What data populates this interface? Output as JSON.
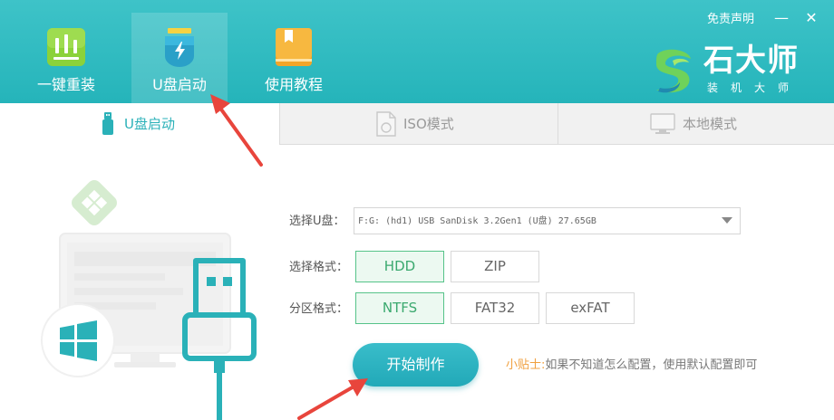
{
  "app": {
    "brand_name": "石大师",
    "brand_sub": "装机大师",
    "disclaimer": "免责声明",
    "minimize": "—",
    "close": "✕"
  },
  "nav": [
    {
      "label": "一键重装",
      "icon": "chart-bars-icon",
      "active": false
    },
    {
      "label": "U盘启动",
      "icon": "usb-drive-icon",
      "active": true
    },
    {
      "label": "使用教程",
      "icon": "book-icon",
      "active": false
    }
  ],
  "tabs": [
    {
      "label": "U盘启动",
      "icon": "usb-stick-icon",
      "active": true
    },
    {
      "label": "ISO模式",
      "icon": "iso-file-icon",
      "active": false
    },
    {
      "label": "本地模式",
      "icon": "monitor-icon",
      "active": false
    }
  ],
  "form": {
    "usb_label": "选择U盘：",
    "usb_value": "F:G: (hd1) USB SanDisk 3.2Gen1 (U盘) 27.65GB",
    "format_label": "选择格式：",
    "format_options": [
      "HDD",
      "ZIP"
    ],
    "format_selected": "HDD",
    "partition_label": "分区格式：",
    "partition_options": [
      "NTFS",
      "FAT32",
      "exFAT"
    ],
    "partition_selected": "NTFS",
    "start_button": "开始制作",
    "tip_prefix": "小贴士:",
    "tip_text": "如果不知道怎么配置，使用默认配置即可"
  },
  "colors": {
    "header": "#2ab8be",
    "accent": "#2ab1b8",
    "selected_green": "#56c389",
    "tip_orange": "#f0a040",
    "arrow_red": "#e8453c"
  }
}
